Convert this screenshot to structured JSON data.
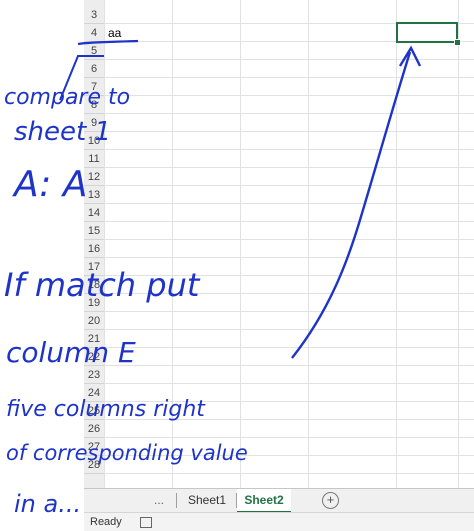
{
  "sheet": {
    "row_numbers": [
      "3",
      "4",
      "5",
      "6",
      "7",
      "8",
      "9",
      "10",
      "11",
      "12",
      "13",
      "14",
      "15",
      "16",
      "17",
      "18",
      "19",
      "20",
      "21",
      "22",
      "23",
      "24",
      "25",
      "26",
      "27",
      "28"
    ],
    "cell_a4": "aa"
  },
  "tabs": {
    "sheet1": "Sheet1",
    "sheet2": "Sheet2",
    "add": "+",
    "more": "..."
  },
  "status": {
    "ready": "Ready"
  },
  "annotation": {
    "line1": "compare to",
    "line2": "sheet 1",
    "line3": "A: A",
    "line4": "If match put",
    "line5": "column E",
    "line6": "five columns right",
    "line7": "of corresponding value",
    "line8": "in a..."
  },
  "colors": {
    "selection": "#217346",
    "ink": "#1e34c8"
  }
}
